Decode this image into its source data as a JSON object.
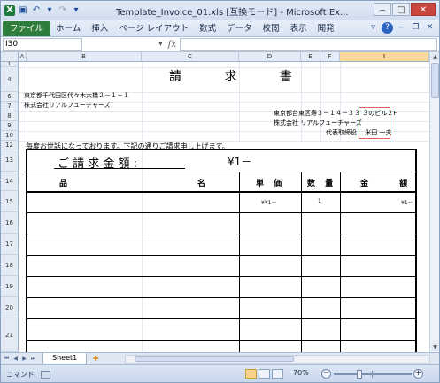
{
  "window": {
    "title": "Template_Invoice_01.xls [互換モード] - Microsoft Ex...",
    "buttons": [
      "‒",
      "□",
      "✕"
    ]
  },
  "ribbon": {
    "tabs": [
      "ファイル",
      "ホーム",
      "挿入",
      "ページ レイアウト",
      "数式",
      "データ",
      "校閲",
      "表示",
      "開発"
    ]
  },
  "formula_bar": {
    "name_box": "I30",
    "fx": "fx",
    "value": ""
  },
  "columns": [
    "A",
    "B",
    "C",
    "D",
    "E",
    "F",
    "G",
    "H",
    "I"
  ],
  "selected_column": "I",
  "rows": [
    "1",
    "4",
    "6",
    "7",
    "8",
    "9",
    "10",
    "12",
    "13",
    "14",
    "15",
    "16",
    "17",
    "18",
    "19",
    "20",
    "21"
  ],
  "invoice": {
    "title": "請 求 書",
    "customer_address": "東京都千代田区代々木大橋２－１－１",
    "customer_name": "株式会社リアルフューチャーズ",
    "sender_address": "東京都台東区寿３－１４－３３ ３のビル２F",
    "sender_name": "株式会社 リアルフューチャーズ",
    "sender_rep": "代表取締役 　米田 一夫",
    "stamp": "株式会社リアルフューチャーズ",
    "greeting": "毎度お世話になっております。下記の通りご請求申し上げます。",
    "amount_label": "ご 請 求 金 額 :",
    "amount_value": "¥1－",
    "headers": {
      "item": "品",
      "item2": "名",
      "unit_price": "単 価",
      "qty": "数 量",
      "amount": "金 額"
    },
    "line1": {
      "unit_price": "¥¥1－",
      "qty": "1",
      "amount": "¥1－"
    }
  },
  "sheet_tabs": [
    "Sheet1"
  ],
  "status": {
    "mode": "コマンド",
    "zoom": "70%"
  }
}
